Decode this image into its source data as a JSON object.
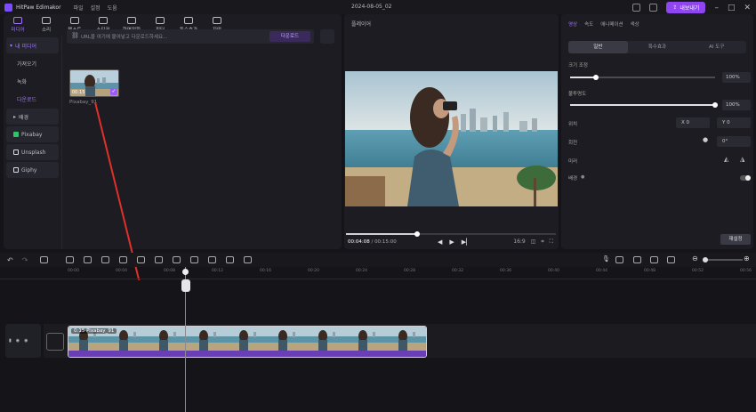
{
  "app": {
    "name": "HitPaw Edimakor",
    "menus": [
      "파일",
      "설정",
      "도움"
    ],
    "doc_title": "2024-08-05_02",
    "export_label": "내보내기",
    "accent": "#8f45f0"
  },
  "media_toolbar": {
    "tabs": [
      {
        "label": "미디어",
        "icon": "folder-icon",
        "active": true
      },
      {
        "label": "소리",
        "icon": "music-icon"
      },
      {
        "label": "텍스트",
        "icon": "text-icon"
      },
      {
        "label": "스티커",
        "icon": "sticker-icon"
      },
      {
        "label": "화면전환",
        "icon": "transition-icon"
      },
      {
        "label": "필터",
        "icon": "filter-icon"
      },
      {
        "label": "특수효과",
        "icon": "effect-icon"
      },
      {
        "label": "자막",
        "icon": "caption-icon"
      }
    ]
  },
  "sidebar": {
    "items": [
      {
        "label": "내 미디어",
        "kind": "head"
      },
      {
        "label": "가져오기",
        "kind": "sub"
      },
      {
        "label": "녹화",
        "kind": "sub"
      },
      {
        "label": "다운로드",
        "kind": "sub",
        "active": true
      },
      {
        "label": "배경",
        "kind": "box"
      },
      {
        "label": "Pixabay",
        "kind": "box"
      },
      {
        "label": "Unsplash",
        "kind": "box"
      },
      {
        "label": "Giphy",
        "kind": "box"
      }
    ]
  },
  "search": {
    "placeholder": "URL을 여기에 붙여넣고 다운로드하세요...",
    "button_label": "다운로드"
  },
  "media_item": {
    "duration": "00:15",
    "name": "Pixabay_91"
  },
  "preview": {
    "title": "플레이어",
    "current_time": "00:04:08",
    "total_time": "00:15:00",
    "ratio_label": "16:9",
    "progress": 0.34
  },
  "properties": {
    "tabs": [
      "영상",
      "속도",
      "애니메이션",
      "색상"
    ],
    "subtabs": [
      "일반",
      "특수효과",
      "AI 도구"
    ],
    "scale_label": "크기 조정",
    "scale_value": "100%",
    "scale_level": 0.18,
    "opacity_label": "불투명도",
    "opacity_value": "100%",
    "opacity_level": 1.0,
    "position_label": "위치",
    "pos_x": "0",
    "pos_y": "0",
    "rotate_label": "회전",
    "rotate_value": "0°",
    "flip_label": "미러",
    "blend_label": "배경",
    "reset_label": "재설정"
  },
  "timeline": {
    "ticks": [
      "00:00",
      "00:04",
      "00:08",
      "00:12",
      "00:16",
      "00:20",
      "00:24",
      "00:28",
      "00:32",
      "00:36",
      "00:40",
      "00:44",
      "00:48",
      "00:52",
      "00:56"
    ],
    "clip_label": "0:15 Pixabay_91",
    "frames": 9
  }
}
